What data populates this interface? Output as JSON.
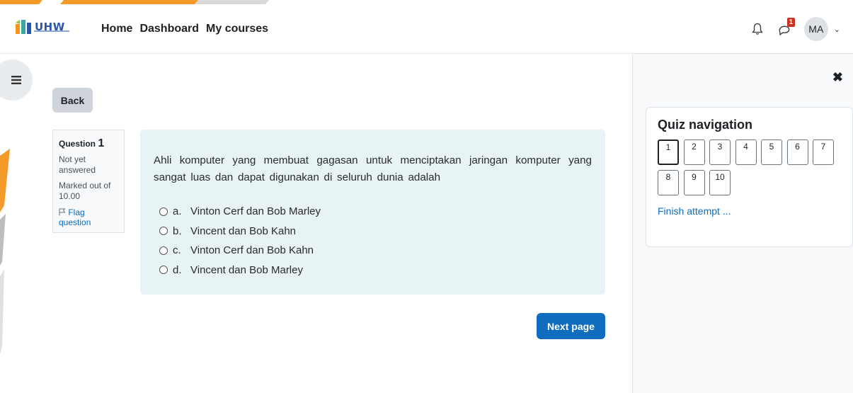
{
  "navbar": {
    "logo_text": "UHW",
    "links": [
      "Home",
      "Dashboard",
      "My courses"
    ],
    "notification_count": "1",
    "user_initials": "MA"
  },
  "main": {
    "back_label": "Back",
    "question_info": {
      "prefix": "Question",
      "number": "1",
      "state": "Not yet answered",
      "grade": "Marked out of 10.00",
      "flag_label": "Flag question"
    },
    "question_text": "Ahli komputer yang membuat gagasan untuk menciptakan jaringan komputer yang sangat luas dan dapat digunakan di seluruh dunia adalah",
    "answers": [
      {
        "letter": "a.",
        "text": "Vinton Cerf dan Bob Marley"
      },
      {
        "letter": "b.",
        "text": "Vincent dan Bob Kahn"
      },
      {
        "letter": "c.",
        "text": "Vinton Cerf dan Bob Kahn"
      },
      {
        "letter": "d.",
        "text": "Vincent dan Bob Marley"
      }
    ],
    "next_label": "Next page"
  },
  "drawer": {
    "title": "Quiz navigation",
    "questions": [
      "1",
      "2",
      "3",
      "4",
      "5",
      "6",
      "7",
      "8",
      "9",
      "10"
    ],
    "finish_label": "Finish attempt ..."
  },
  "icons": {
    "bell": "bell-icon",
    "messages": "chat-icon",
    "drawer_toggle": "list-icon",
    "close": "close-icon",
    "flag": "flag-icon"
  },
  "colors": {
    "accent": "#0f6cbf",
    "question_bg": "#e7f3f5",
    "badge": "#ca3120",
    "brand_orange": "#f7941d"
  }
}
